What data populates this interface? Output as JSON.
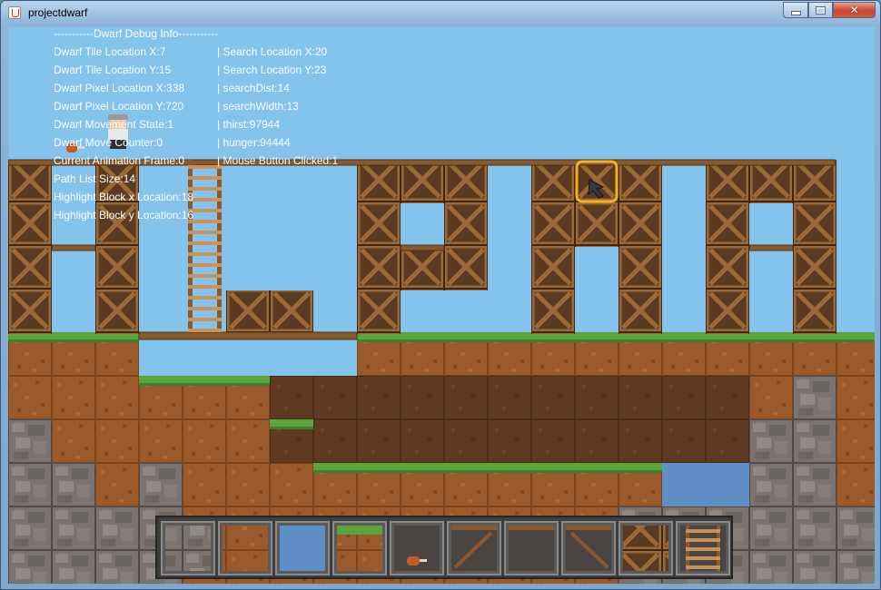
{
  "window": {
    "title": "projectdwarf",
    "minimize_icon": "minimize-icon",
    "maximize_icon": "maximize-icon",
    "close_icon": "close-icon",
    "close_glyph": "✕"
  },
  "debug": {
    "header": "-----------Dwarf Debug Info-----------",
    "left": [
      "Dwarf Tile Location X:7",
      "Dwarf Tile Location Y:15",
      "Dwarf Pixel Location X:338",
      "Dwarf Pixel Location Y:720",
      "Dwarf Movement State:1",
      "Dwarf Move Counter:0",
      "Current Animation Frame:0",
      "Path List Size:14",
      "Highlight Block x Location:18",
      "Highlight Block y Location:16"
    ],
    "right": [
      "| Search Location X:20",
      "| Search Location Y:23",
      "| searchDist:14",
      "| searchWidth:13",
      "| thirst:97944",
      "| hunger:94444",
      "| Mouse Button Clicked:1"
    ]
  },
  "colors": {
    "sky": "#84c3eb",
    "dirt": "#9a5a2c",
    "dirt_dark": "#5e3a22",
    "grass": "#5aa43b",
    "stone": "#7a7370",
    "water": "#5f8fc4",
    "wood": "#8a5a2e",
    "highlight": "#f2b21b",
    "hotbar_bg": "#3e3e3e"
  },
  "hotbar": {
    "slots": [
      {
        "icon": "stone-block-icon",
        "selected": false
      },
      {
        "icon": "dirt-block-icon",
        "selected": false
      },
      {
        "icon": "water-block-icon",
        "selected": false
      },
      {
        "icon": "grass-block-icon",
        "selected": false
      },
      {
        "icon": "meat-item-icon",
        "selected": false
      },
      {
        "icon": "wood-stairs-left-icon",
        "selected": false
      },
      {
        "icon": "wood-platform-icon",
        "selected": false
      },
      {
        "icon": "wood-stairs-right-icon",
        "selected": false
      },
      {
        "icon": "wood-crate-icon",
        "selected": false
      },
      {
        "icon": "ladder-icon",
        "selected": false
      }
    ]
  }
}
